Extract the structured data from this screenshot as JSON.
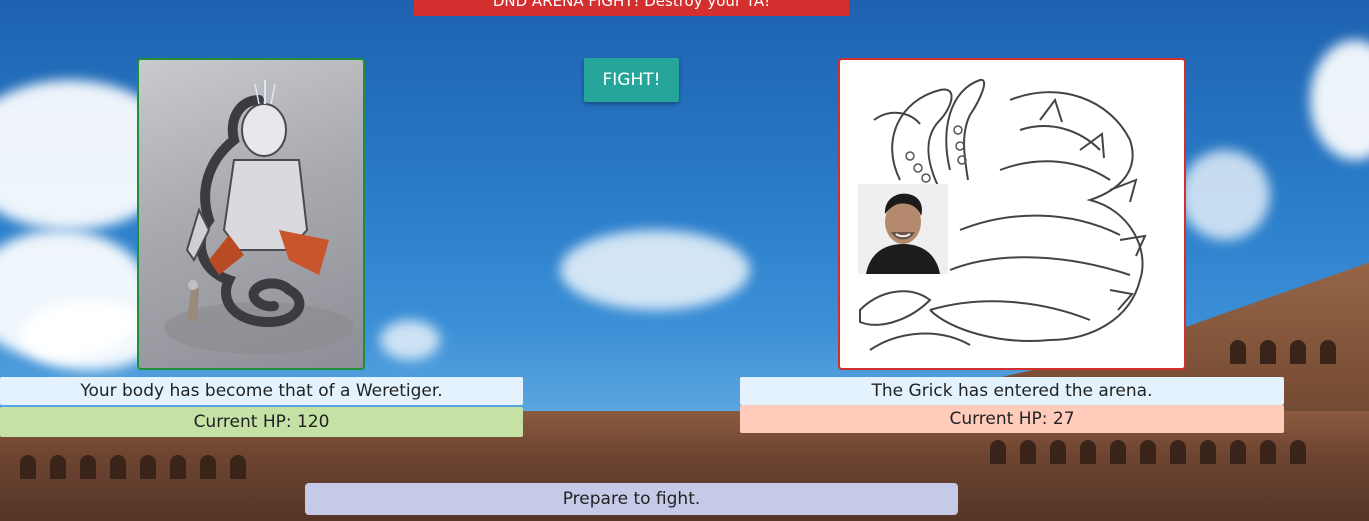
{
  "header": {
    "banner_text": "DND ARENA FIGHT! Destroy your TA!",
    "banner_color": "#d32f2f"
  },
  "controls": {
    "fight_label": "FIGHT!",
    "fight_color": "#26a69a"
  },
  "player": {
    "description": "Your body has become that of a Weretiger.",
    "hp_text": "Current HP: 120",
    "border_color": "#1f8f3a",
    "hp_bar_color": "#c5e1a5",
    "image": "weretiger-illustration"
  },
  "enemy": {
    "description": "The Grick has entered the arena.",
    "hp_text": "Current HP: 27",
    "border_color": "#d32f2f",
    "hp_bar_color": "#ffccbc",
    "image": "grick-sketch",
    "portrait": "ta-headshot"
  },
  "status": {
    "message": "Prepare to fight.",
    "bar_color": "#c5cae9"
  },
  "background": {
    "image": "colosseum-sky"
  }
}
